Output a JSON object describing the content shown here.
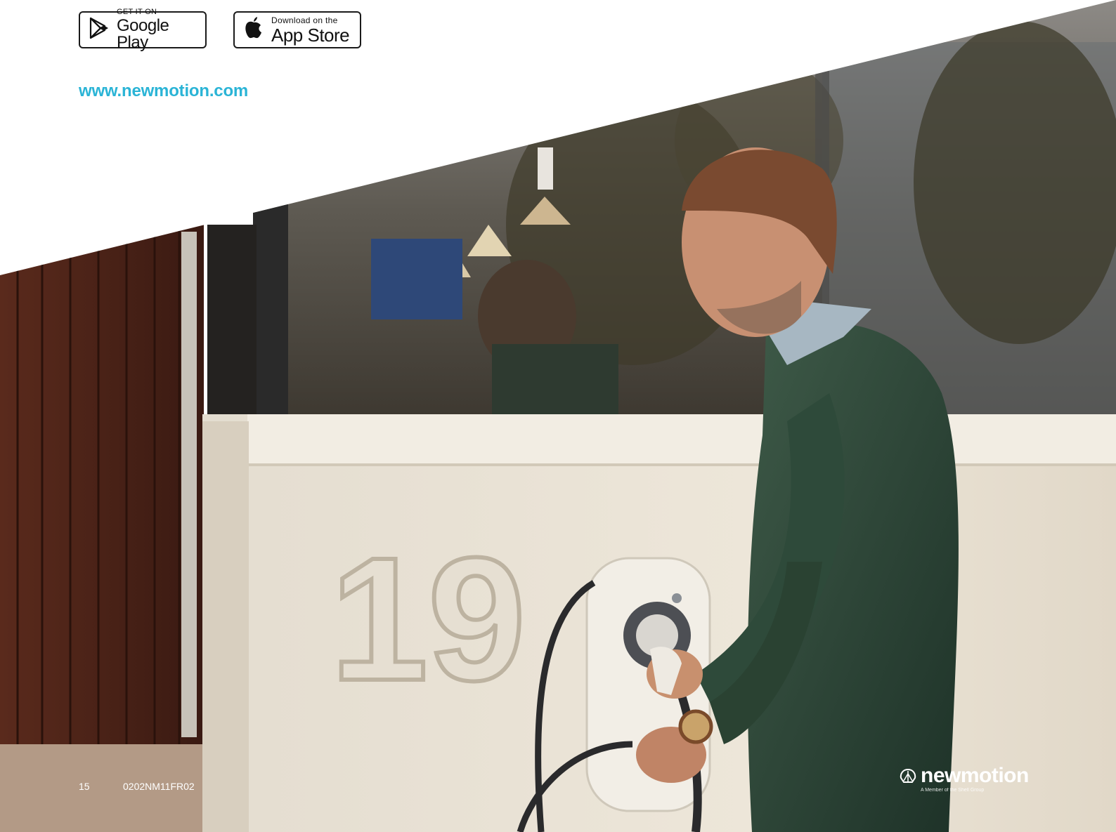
{
  "badges": {
    "google": {
      "top": "GET IT ON",
      "main": "Google Play"
    },
    "apple": {
      "top": "Download on the",
      "main": "App Store"
    }
  },
  "website": "www.newmotion.com",
  "photo": {
    "house_number": "19"
  },
  "footer": {
    "page_number": "15",
    "doc_code": "0202NM11FR02"
  },
  "logo": {
    "name_part1": "new",
    "name_part2": "motion",
    "tagline": "A Member of the Shell Group"
  },
  "colors": {
    "link": "#2ab4d6"
  }
}
